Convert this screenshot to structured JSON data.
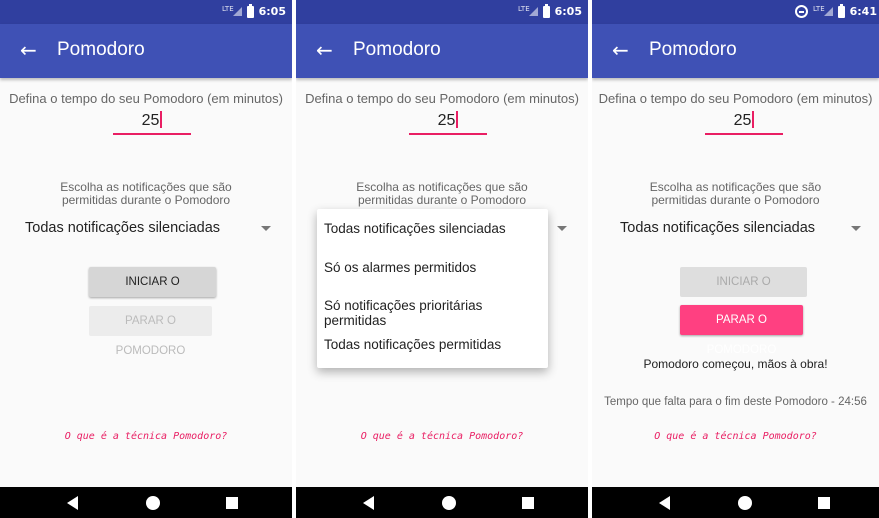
{
  "status": {
    "time_1": "6:05",
    "time_2": "6:05",
    "time_3": "6:41",
    "network": "LTE"
  },
  "app": {
    "title": "Pomodoro"
  },
  "form": {
    "prompt": "Defina o tempo do seu Pomodoro (em minutos)",
    "minutes_value": "25",
    "notif_prompt_line1": "Escolha as notificações que são",
    "notif_prompt_line2": "permitidas durante o Pomodoro",
    "selected_notification": "Todas notificações silenciadas"
  },
  "buttons": {
    "start": "INICIAR O POMODORO",
    "stop": "PARAR O POMODORO"
  },
  "dropdown": {
    "options": [
      "Todas notificações silenciadas",
      "Só os alarmes permitidos",
      "Só notificações prioritárias permitidas",
      "Todas notificações permitidas"
    ]
  },
  "running": {
    "message": "Pomodoro começou, mãos à obra!",
    "time_left": "Tempo que falta para o fim deste Pomodoro - 24:56"
  },
  "link": {
    "text": "O que é a técnica Pomodoro?"
  }
}
